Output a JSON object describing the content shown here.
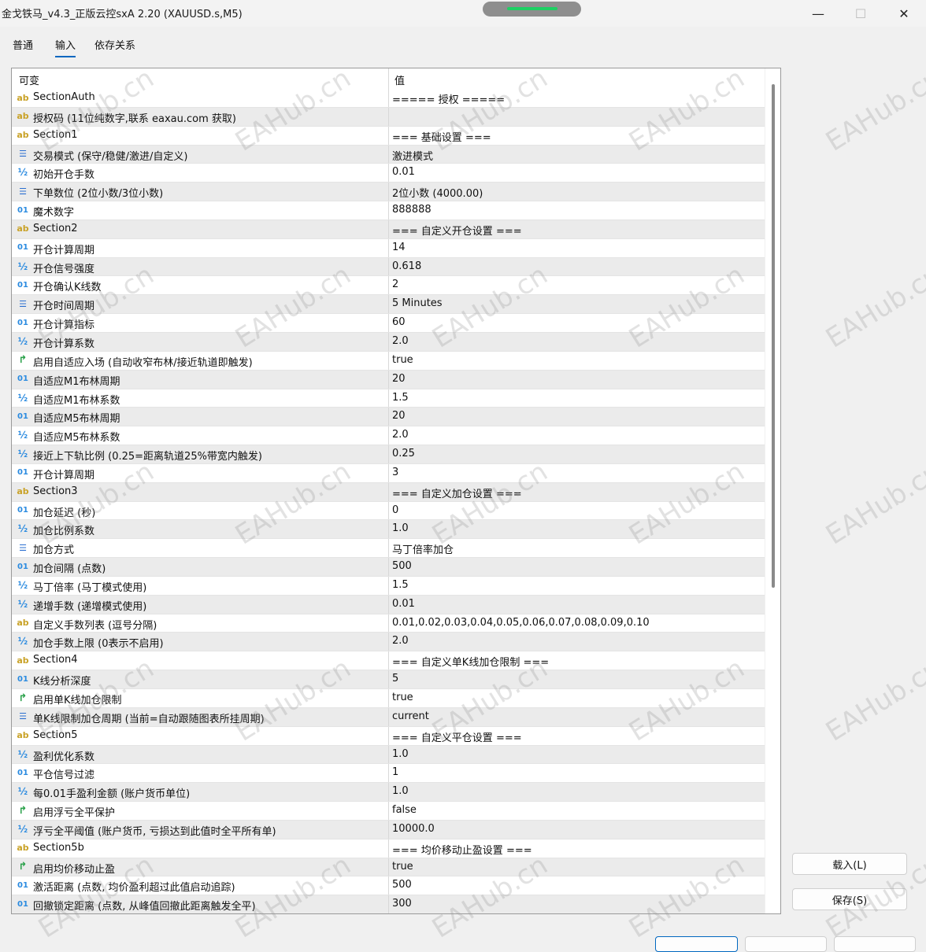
{
  "window": {
    "title": "金戈铁马_v4.3_正版云控sxA 2.20 (XAUUSD.s,M5)",
    "minimize_glyph": "—",
    "maximize_glyph": "☐",
    "close_glyph": "✕"
  },
  "tabs": [
    {
      "label": "普通",
      "active": false
    },
    {
      "label": "输入",
      "active": true
    },
    {
      "label": "依存关系",
      "active": false
    }
  ],
  "grid": {
    "headers": {
      "variable": "可变",
      "value": "值"
    },
    "rows": [
      {
        "type": "ab",
        "name": "SectionAuth",
        "value": "===== 授权 ====="
      },
      {
        "type": "ab",
        "name": "授权码 (11位纯数字,联系 eaxau.com 获取)",
        "value": ""
      },
      {
        "type": "ab",
        "name": "Section1",
        "value": "=== 基础设置 ==="
      },
      {
        "type": "list",
        "name": "交易模式 (保守/稳健/激进/自定义)",
        "value": "激进模式"
      },
      {
        "type": "half",
        "name": "初始开仓手数",
        "value": "0.01"
      },
      {
        "type": "list",
        "name": "下单数位 (2位小数/3位小数)",
        "value": "2位小数 (4000.00)"
      },
      {
        "type": "01",
        "name": "魔术数字",
        "value": "888888"
      },
      {
        "type": "ab",
        "name": "Section2",
        "value": "=== 自定义开仓设置 ==="
      },
      {
        "type": "01",
        "name": "开仓计算周期",
        "value": "14"
      },
      {
        "type": "half",
        "name": "开仓信号强度",
        "value": "0.618"
      },
      {
        "type": "01",
        "name": "开仓确认K线数",
        "value": "2"
      },
      {
        "type": "list",
        "name": "开仓时间周期",
        "value": "5 Minutes"
      },
      {
        "type": "01",
        "name": "开仓计算指标",
        "value": "60"
      },
      {
        "type": "half",
        "name": "开仓计算系数",
        "value": "2.0"
      },
      {
        "type": "bool",
        "name": "启用自适应入场 (自动收窄布林/接近轨道即触发)",
        "value": "true"
      },
      {
        "type": "01",
        "name": "自适应M1布林周期",
        "value": "20"
      },
      {
        "type": "half",
        "name": "自适应M1布林系数",
        "value": "1.5"
      },
      {
        "type": "01",
        "name": "自适应M5布林周期",
        "value": "20"
      },
      {
        "type": "half",
        "name": "自适应M5布林系数",
        "value": "2.0"
      },
      {
        "type": "half",
        "name": "接近上下轨比例 (0.25=距离轨道25%带宽内触发)",
        "value": "0.25"
      },
      {
        "type": "01",
        "name": "开仓计算周期",
        "value": "3"
      },
      {
        "type": "ab",
        "name": "Section3",
        "value": "=== 自定义加仓设置 ==="
      },
      {
        "type": "01",
        "name": "加仓延迟 (秒)",
        "value": "0"
      },
      {
        "type": "half",
        "name": "加仓比例系数",
        "value": "1.0"
      },
      {
        "type": "list",
        "name": "加仓方式",
        "value": "马丁倍率加仓"
      },
      {
        "type": "01",
        "name": "加仓间隔 (点数)",
        "value": "500"
      },
      {
        "type": "half",
        "name": "马丁倍率 (马丁模式使用)",
        "value": "1.5"
      },
      {
        "type": "half",
        "name": "递增手数 (递增模式使用)",
        "value": "0.01"
      },
      {
        "type": "ab",
        "name": "自定义手数列表 (逗号分隔)",
        "value": "0.01,0.02,0.03,0.04,0.05,0.06,0.07,0.08,0.09,0.10"
      },
      {
        "type": "half",
        "name": "加仓手数上限 (0表示不启用)",
        "value": "2.0"
      },
      {
        "type": "ab",
        "name": "Section4",
        "value": "=== 自定义单K线加仓限制 ==="
      },
      {
        "type": "01",
        "name": "K线分析深度",
        "value": "5"
      },
      {
        "type": "bool",
        "name": "启用单K线加仓限制",
        "value": "true"
      },
      {
        "type": "list",
        "name": "单K线限制加仓周期 (当前=自动跟随图表所挂周期)",
        "value": "current"
      },
      {
        "type": "ab",
        "name": "Section5",
        "value": "=== 自定义平仓设置 ==="
      },
      {
        "type": "half",
        "name": "盈利优化系数",
        "value": "1.0"
      },
      {
        "type": "01",
        "name": "平仓信号过滤",
        "value": "1"
      },
      {
        "type": "half",
        "name": "每0.01手盈利金额 (账户货币单位)",
        "value": "1.0"
      },
      {
        "type": "bool",
        "name": "启用浮亏全平保护",
        "value": "false"
      },
      {
        "type": "half",
        "name": "浮亏全平阈值 (账户货币, 亏损达到此值时全平所有单)",
        "value": "10000.0"
      },
      {
        "type": "ab",
        "name": "Section5b",
        "value": "=== 均价移动止盈设置 ==="
      },
      {
        "type": "bool",
        "name": "启用均价移动止盈",
        "value": "true"
      },
      {
        "type": "01",
        "name": "激活距离 (点数, 均价盈利超过此值启动追踪)",
        "value": "500"
      },
      {
        "type": "01",
        "name": "回撤锁定距离 (点数, 从峰值回撤此距离触发全平)",
        "value": "300"
      }
    ]
  },
  "icons": {
    "ab": "ab",
    "half": "½",
    "01": "01",
    "list": "☰",
    "bool": "↱"
  },
  "buttons": {
    "load": "载入(L)",
    "save": "保存(S)"
  },
  "watermark": "EAHub.cn"
}
